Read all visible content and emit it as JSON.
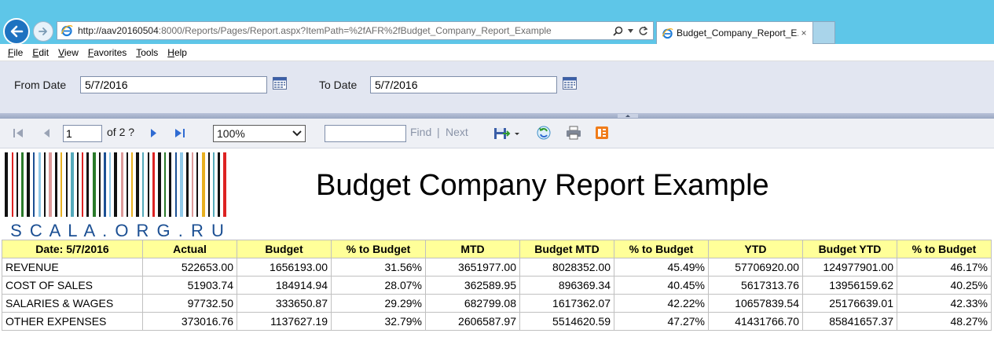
{
  "browser": {
    "url_host": "http://aav20160504",
    "url_rest": ":8000/Reports/Pages/Report.aspx?ItemPath=%2fAFR%2fBudget_Company_Report_Example",
    "tab_title": "Budget_Company_Report_E...",
    "tab_close": "×"
  },
  "menu": [
    "File",
    "Edit",
    "View",
    "Favorites",
    "Tools",
    "Help"
  ],
  "params": {
    "from_label": "From Date",
    "from_value": "5/7/2016",
    "to_label": "To Date",
    "to_value": "5/7/2016"
  },
  "toolbar": {
    "page_value": "1",
    "page_of": "of 2 ?",
    "zoom": "100%",
    "find_value": "",
    "find_label": "Find",
    "separator": "|",
    "next_label": "Next"
  },
  "report": {
    "logo_text": "S C A L A . O R G . R U",
    "title": "Budget Company Report Example",
    "columns": [
      "Date: 5/7/2016",
      "Actual",
      "Budget",
      "% to Budget",
      "MTD",
      "Budget MTD",
      "% to Budget",
      "YTD",
      "Budget YTD",
      "% to Budget"
    ],
    "rows": [
      [
        "REVENUE",
        "522653.00",
        "1656193.00",
        "31.56%",
        "3651977.00",
        "8028352.00",
        "45.49%",
        "57706920.00",
        "124977901.00",
        "46.17%"
      ],
      [
        "COST OF SALES",
        "51903.74",
        "184914.94",
        "28.07%",
        "362589.95",
        "896369.34",
        "40.45%",
        "5617313.76",
        "13956159.62",
        "40.25%"
      ],
      [
        "SALARIES & WAGES",
        "97732.50",
        "333650.87",
        "29.29%",
        "682799.08",
        "1617362.07",
        "42.22%",
        "10657839.54",
        "25176639.01",
        "42.33%"
      ],
      [
        "OTHER EXPENSES",
        "373016.76",
        "1137627.19",
        "32.79%",
        "2606587.97",
        "5514620.59",
        "47.27%",
        "41431766.70",
        "85841657.37",
        "48.27%"
      ]
    ]
  },
  "colors": {
    "titlebar": "#5ec6e8",
    "params_bg": "#e2e6f1",
    "header_bg": "#ffff99"
  }
}
